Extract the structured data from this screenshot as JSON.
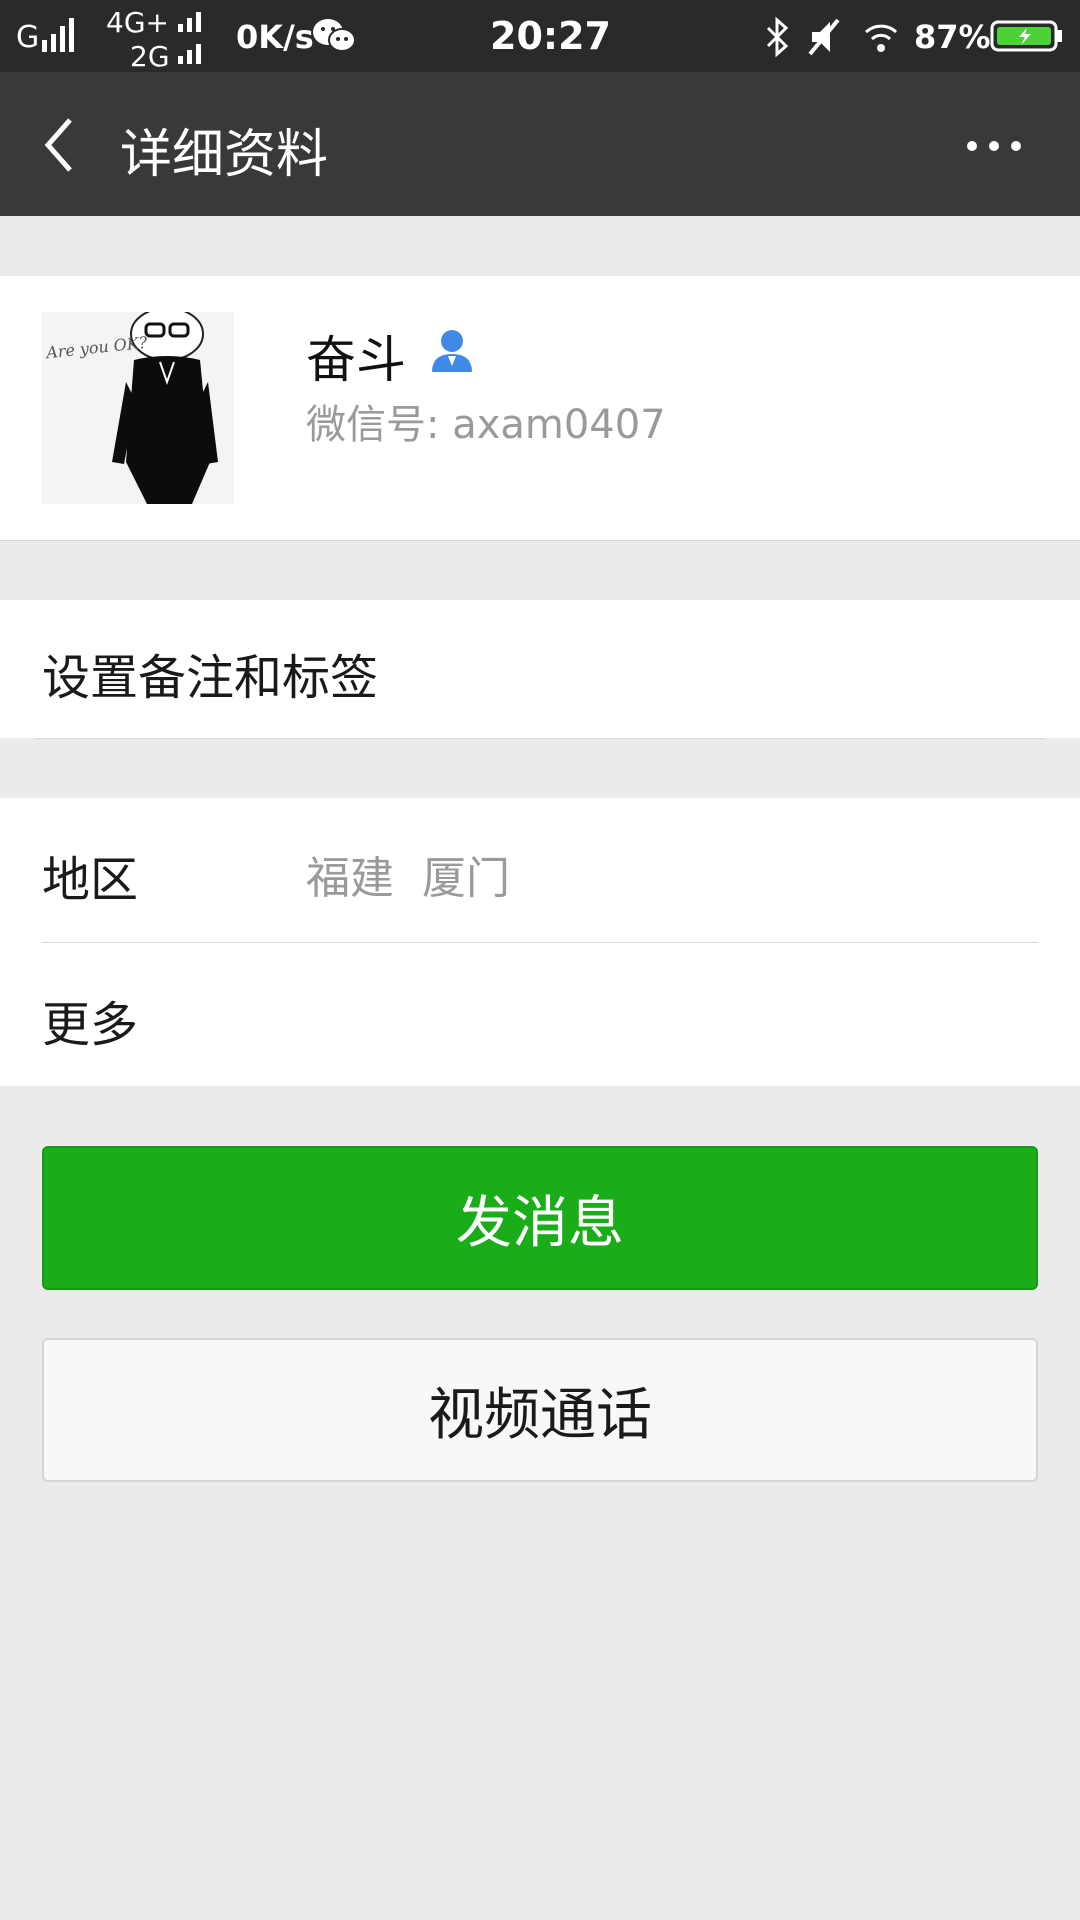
{
  "status_bar": {
    "carrier1": "G",
    "carrier2_top": "4G+",
    "carrier2_bottom": "2G",
    "speed": "0K/s",
    "time": "20:27",
    "battery": "87%"
  },
  "nav": {
    "title": "详细资料"
  },
  "profile": {
    "name": "奋斗",
    "wechat_id": "微信号: axam0407",
    "avatar_caption": "Are you OK?"
  },
  "remark_row": {
    "label": "设置备注和标签"
  },
  "region_row": {
    "label": "地区",
    "value": "福建  厦门"
  },
  "more_row": {
    "label": "更多"
  },
  "buttons": {
    "send_message": "发消息",
    "video_call": "视频通话"
  },
  "colors": {
    "accent_green": "#1aad19",
    "nav_bg": "#393939",
    "status_bg": "#2a2a2a",
    "page_bg": "#ebebeb"
  }
}
